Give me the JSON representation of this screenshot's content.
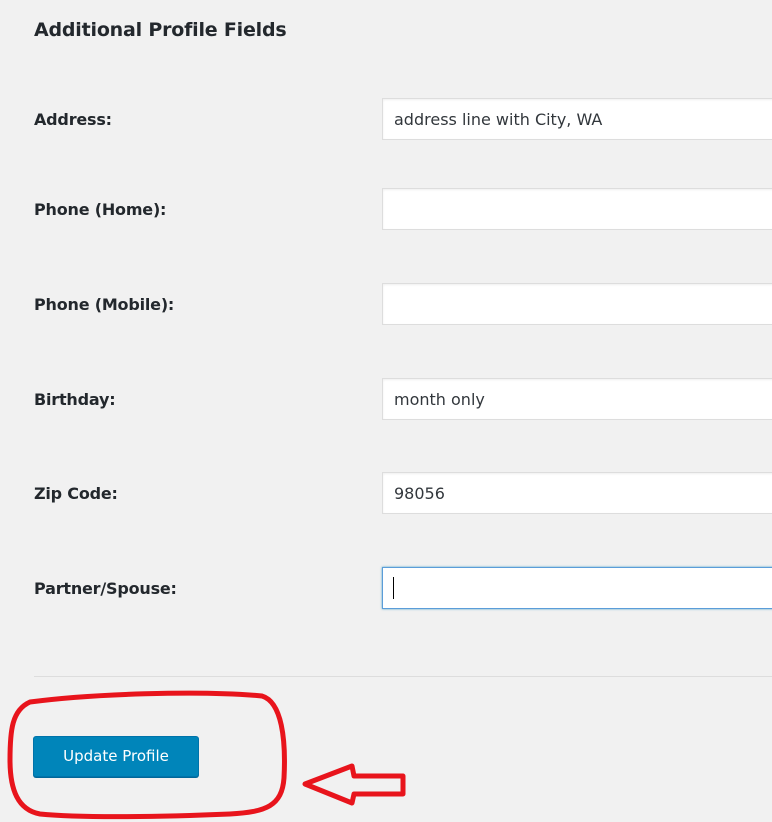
{
  "section": {
    "title": "Additional Profile Fields"
  },
  "fields": [
    {
      "label": "Address:",
      "value": "address line with City, WA",
      "placeholder": ""
    },
    {
      "label": "Phone (Home):",
      "value": "",
      "placeholder": ""
    },
    {
      "label": "Phone (Mobile):",
      "value": "",
      "placeholder": ""
    },
    {
      "label": "Birthday:",
      "value": "month only",
      "placeholder": ""
    },
    {
      "label": "Zip Code:",
      "value": "98056",
      "placeholder": ""
    },
    {
      "label": "Partner/Spouse:",
      "value": "",
      "placeholder": "",
      "focused": true
    }
  ],
  "actions": {
    "update_label": "Update Profile"
  },
  "annotation": {
    "color": "#e8141c",
    "shapes": [
      "highlight-circle",
      "left-arrow"
    ]
  },
  "colors": {
    "background": "#f1f1f1",
    "button": "#0085ba",
    "focus_border": "#5b9dd9"
  }
}
